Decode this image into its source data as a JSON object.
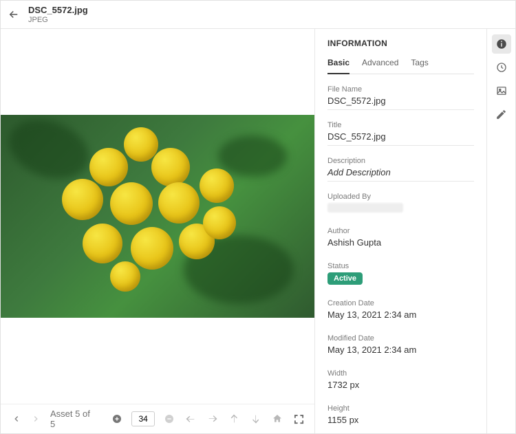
{
  "header": {
    "filename": "DSC_5572.jpg",
    "filetype": "JPEG"
  },
  "footer": {
    "asset_position": "Asset 5 of 5",
    "zoom_value": "34"
  },
  "panel": {
    "title": "INFORMATION",
    "tabs": {
      "basic": "Basic",
      "advanced": "Advanced",
      "tags": "Tags"
    },
    "labels": {
      "file_name": "File Name",
      "title": "Title",
      "description": "Description",
      "uploaded_by": "Uploaded By",
      "author": "Author",
      "status": "Status",
      "creation_date": "Creation Date",
      "modified_date": "Modified Date",
      "width": "Width",
      "height": "Height"
    },
    "values": {
      "file_name": "DSC_5572.jpg",
      "title": "DSC_5572.jpg",
      "description_placeholder": "Add Description",
      "author": "Ashish Gupta",
      "status": "Active",
      "creation_date": "May 13, 2021 2:34 am",
      "modified_date": "May 13, 2021 2:34 am",
      "width": "1732 px",
      "height": "1155 px"
    },
    "status_color": "#2d9d78"
  }
}
